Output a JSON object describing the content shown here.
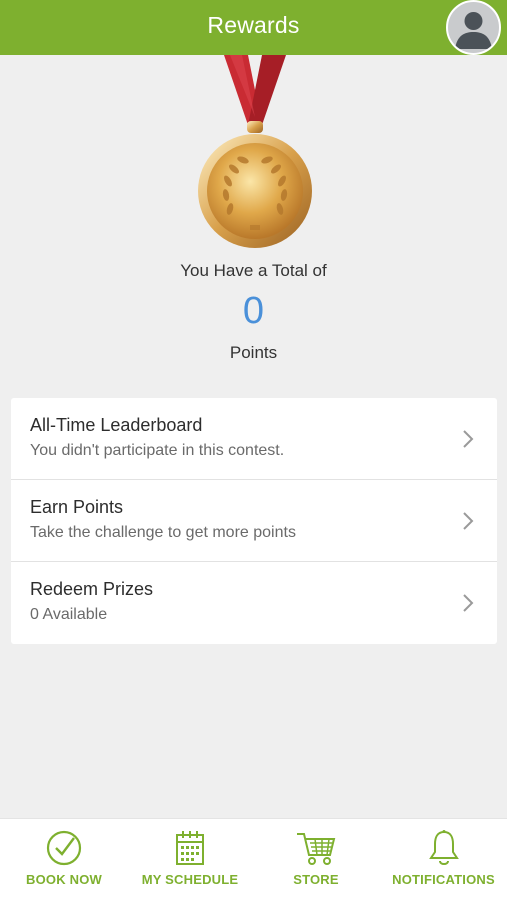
{
  "header": {
    "title": "Rewards"
  },
  "summary": {
    "total_label": "You Have a Total of",
    "points": "0",
    "points_label": "Points"
  },
  "menu": [
    {
      "title": "All-Time Leaderboard",
      "subtitle": "You didn't participate in this contest."
    },
    {
      "title": "Earn Points",
      "subtitle": "Take the challenge to get more points"
    },
    {
      "title": "Redeem Prizes",
      "subtitle": "0 Available"
    }
  ],
  "tabbar": [
    {
      "label": "BOOK NOW",
      "icon": "check-circle-icon"
    },
    {
      "label": "MY SCHEDULE",
      "icon": "calendar-icon"
    },
    {
      "label": "STORE",
      "icon": "cart-icon"
    },
    {
      "label": "NOTIFICATIONS",
      "icon": "bell-icon"
    }
  ],
  "colors": {
    "accent": "#7eb02f",
    "points": "#4a90d9",
    "background": "#efefef"
  }
}
